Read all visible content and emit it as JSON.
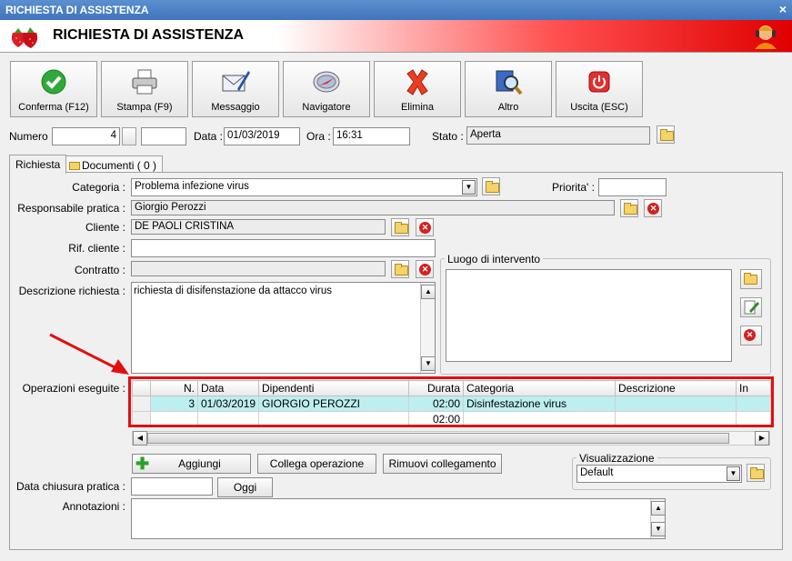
{
  "window": {
    "title": "RICHIESTA DI ASSISTENZA",
    "close": "×"
  },
  "header": {
    "title": "RICHIESTA DI ASSISTENZA"
  },
  "toolbar": [
    {
      "label": "Conferma (F12)",
      "icon": "check-icon"
    },
    {
      "label": "Stampa (F9)",
      "icon": "printer-icon"
    },
    {
      "label": "Messaggio",
      "icon": "envelope-icon"
    },
    {
      "label": "Navigatore",
      "icon": "compass-icon"
    },
    {
      "label": "Elimina",
      "icon": "delete-x-icon"
    },
    {
      "label": "Altro",
      "icon": "magnifier-icon"
    },
    {
      "label": "Uscita (ESC)",
      "icon": "power-icon"
    }
  ],
  "info": {
    "numero_label": "Numero :",
    "numero": "4",
    "data_label": "Data :",
    "data": "01/03/2019",
    "ora_label": "Ora :",
    "ora": "16:31",
    "stato_label": "Stato :",
    "stato": "Aperta"
  },
  "tabs": [
    {
      "label": "Richiesta"
    },
    {
      "label": "Documenti ( 0 )"
    }
  ],
  "form": {
    "categoria_label": "Categoria :",
    "categoria": "Problema infezione virus",
    "priorita_label": "Priorita' :",
    "priorita": "",
    "responsabile_label": "Responsabile pratica :",
    "responsabile": "Giorgio Perozzi",
    "cliente_label": "Cliente :",
    "cliente": "DE PAOLI CRISTINA",
    "rif_cliente_label": "Rif. cliente :",
    "rif_cliente": "",
    "contratto_label": "Contratto :",
    "contratto": "",
    "descrizione_label": "Descrizione richiesta :",
    "descrizione": "richiesta di disifenstazione da attacco virus",
    "luogo_label": "Luogo di intervento",
    "operazioni_label": "Operazioni eseguite :",
    "data_chiusura_label": "Data chiusura pratica :",
    "data_chiusura": "",
    "oggi_label": "Oggi",
    "annotazioni_label": "Annotazioni :",
    "visualizzazione_label": "Visualizzazione",
    "visualizzazione": "Default"
  },
  "grid": {
    "columns": [
      "N.",
      "Data",
      "Dipendenti",
      "Durata",
      "Categoria",
      "Descrizione",
      "In"
    ],
    "rows": [
      [
        "3",
        "01/03/2019",
        "GIORGIO PEROZZI",
        "02:00",
        "Disinfestazione virus",
        "",
        ""
      ],
      [
        "",
        "",
        "",
        "02:00",
        "",
        "",
        ""
      ]
    ]
  },
  "buttons": {
    "aggiungi": "Aggiungi",
    "collega": "Collega operazione",
    "rimuovi": "Rimuovi collegamento"
  },
  "colors": {
    "accent": "#e01010",
    "selected_row": "#bdeef0"
  }
}
